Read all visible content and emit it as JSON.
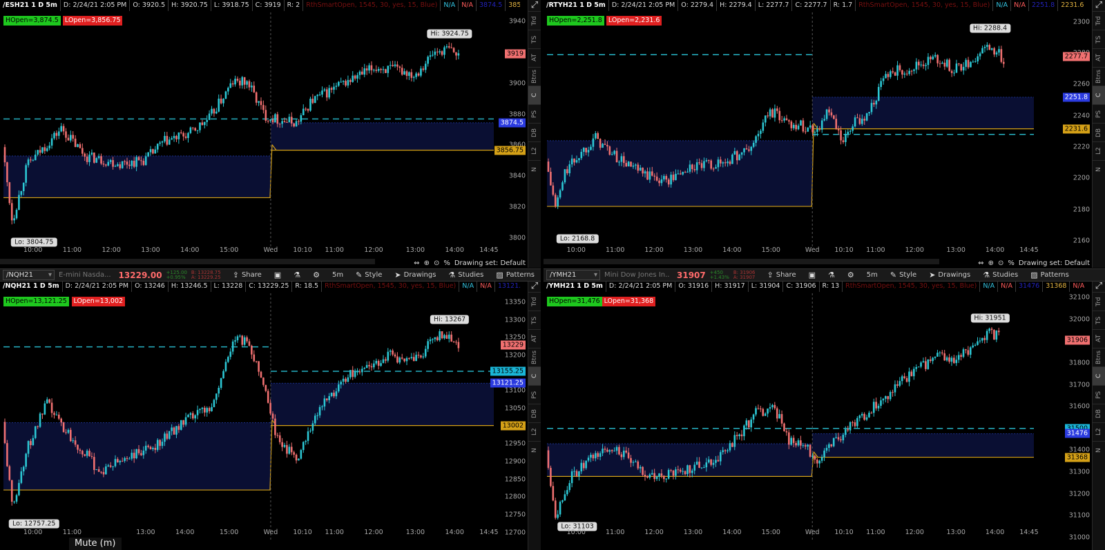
{
  "colors": {
    "up": "#2cc7d4",
    "down": "#f07070",
    "gold": "#d4a017",
    "cyan_dash": "#26b3c4",
    "fill": "#0a0f33"
  },
  "panels": [
    {
      "id": "es",
      "info": {
        "symbol": "/ESH21 1 D 5m",
        "date": "D: 2/24/21 2:05 PM",
        "o": "O: 3920.5",
        "h": "H: 3920.75",
        "l": "L: 3918.75",
        "c": "C: 3919",
        "r": "R: 2",
        "study": "RthSmartOpen, 1545, 30, yes, 15, Blue)",
        "na1": "N/A",
        "na2": "N/A",
        "blueval": "3874.5",
        "goldval": "3856.75",
        "na3": "N/A",
        "na4": "N/A"
      },
      "hopen": "HOpen=3,874.5",
      "lopen": "LOpen=3,856.75",
      "hi": "Hi: 3924.75",
      "lo": "Lo: 3804.75",
      "yticks": [
        "3940",
        "3920",
        "3900",
        "3880",
        "3860",
        "3840",
        "3820",
        "3800"
      ],
      "xticks": [
        "10:00",
        "11:00",
        "12:00",
        "13:00",
        "14:00",
        "15:00",
        "Wed",
        "10:10",
        "11:00",
        "12:00",
        "13:00",
        "14:00",
        "14:45"
      ],
      "labels": {
        "last": "3919",
        "blue": "3874.5",
        "gold": "3856.75"
      },
      "chart_data": {
        "type": "candlestick",
        "ylim": [
          3794,
          3946
        ],
        "open": 3868,
        "close": 3919,
        "lo": 3804.75,
        "hi": 3924.75,
        "hopen": 3874.5,
        "lopen": 3856.75,
        "prev_fill_top": 3853,
        "prev_fill_bottom": 3826
      }
    },
    {
      "id": "rty",
      "info": {
        "symbol": "/RTYH21 1 D 5m",
        "date": "D: 2/24/21 2:05 PM",
        "o": "O: 2279.4",
        "h": "H: 2279.4",
        "l": "L: 2277.7",
        "c": "C: 2277.7",
        "r": "R: 1.7",
        "study": "RthSmartOpen, 1545, 30, yes, 15, Blue)",
        "na1": "N/A",
        "na2": "N/A",
        "blueval": "2251.8",
        "goldval": "2231.6",
        "na3": "N/A",
        "na4": "N/A"
      },
      "hopen": "HOpen=2,251.8",
      "lopen": "LOpen=2,231.6",
      "hi": "Hi: 2288.4",
      "lo": "Lo: 2168.8",
      "yticks": [
        "2300",
        "2280",
        "2260",
        "2240",
        "2220",
        "2200",
        "2180",
        "2160"
      ],
      "xticks": [
        "10:00",
        "11:00",
        "12:00",
        "13:00",
        "14:00",
        "15:00",
        "Wed",
        "10:10",
        "11:00",
        "12:00",
        "13:00",
        "14:00",
        "14:45"
      ],
      "labels": {
        "last": "2277.7",
        "blue": "2251.8",
        "gold": "2231.6"
      },
      "chart_data": {
        "type": "candlestick",
        "ylim": [
          2156,
          2306
        ],
        "open": 2200,
        "close": 2277.7,
        "lo": 2168.8,
        "hi": 2288.4,
        "hopen": 2251.8,
        "lopen": 2231.6,
        "prev_fill_top": 2224,
        "prev_fill_bottom": 2182
      }
    },
    {
      "id": "nq",
      "info": {
        "symbol": "/NQH21 1 D 5m",
        "date": "D: 2/24/21 2:05 PM",
        "o": "O: 13246",
        "h": "H: 13246.5",
        "l": "L: 13228",
        "c": "C: 13229.25",
        "r": "R: 18.5",
        "study": "RthSmartOpen, 1545, 30, yes, 15, Blue)",
        "na1": "N/A",
        "na2": "N/A",
        "blueval": "13121.25",
        "goldval": "13002",
        "na3": "N/A",
        "na4": "N/A"
      },
      "hopen": "HOpen=13,121.25",
      "lopen": "LOpen=13,002",
      "hi": "Hi: 13267",
      "lo": "Lo: 12757.25",
      "yticks": [
        "13350",
        "13300",
        "13250",
        "13200",
        "13150",
        "13100",
        "13050",
        "13000",
        "12950",
        "12900",
        "12850",
        "12800",
        "12750",
        "12700"
      ],
      "xticks": [
        "10:00",
        "11:00",
        "13:00",
        "14:00",
        "15:00",
        "Wed",
        "10:10",
        "11:00",
        "12:00",
        "13:00",
        "14:00",
        "14:45"
      ],
      "labels": {
        "last": "13229",
        "cyan": "13155.25",
        "blue": "13121.25",
        "gold": "13002"
      },
      "chart_data": {
        "type": "candlestick",
        "ylim": [
          12680,
          13375
        ],
        "open": 12950,
        "close": 13229.25,
        "lo": 12757.25,
        "hi": 13267,
        "hopen": 13121.25,
        "lopen": 13002,
        "prev_fill_top": 13010,
        "prev_fill_bottom": 12820
      }
    },
    {
      "id": "ym",
      "info": {
        "symbol": "/YMH21 1 D 5m",
        "date": "D: 2/24/21 2:05 PM",
        "o": "O: 31916",
        "h": "H: 31917",
        "l": "L: 31904",
        "c": "C: 31906",
        "r": "R: 13",
        "study": "RthSmartOpen, 1545, 30, yes, 15, Blue)",
        "na1": "N/A",
        "na2": "N/A",
        "blueval": "31476",
        "goldval": "31368",
        "na3": "N/A",
        "na4": "N/A"
      },
      "hopen": "HOpen=31,476",
      "lopen": "LOpen=31,368",
      "hi": "Hi: 31951",
      "lo": "Lo: 31103",
      "yticks": [
        "32100",
        "32000",
        "31900",
        "31800",
        "31700",
        "31600",
        "31500",
        "31400",
        "31300",
        "31200",
        "31100",
        "31000"
      ],
      "xticks": [
        "10:00",
        "11:00",
        "12:00",
        "13:00",
        "14:00",
        "15:00",
        "Wed",
        "10:10",
        "11:00",
        "12:00",
        "13:00",
        "14:00",
        "14:45"
      ],
      "labels": {
        "last": "31906",
        "cyan": "31500",
        "blue": "31476",
        "gold": "31368"
      },
      "chart_data": {
        "type": "candlestick",
        "ylim": [
          30990,
          32120
        ],
        "open": 31300,
        "close": 31906,
        "lo": 31103,
        "hi": 31951,
        "hopen": 31476,
        "lopen": 31368,
        "prev_fill_top": 31430,
        "prev_fill_bottom": 31280
      }
    }
  ],
  "sidebar_items": [
    "Trd",
    "TS",
    "AT",
    "Btns",
    "C",
    "PS",
    "DB",
    "L2",
    "N"
  ],
  "nav": {
    "drawing_set": "Drawing set: Default",
    "pct": "%"
  },
  "toolbars": [
    {
      "symbol": "/NQH21",
      "desc": "E-mini Nasda...",
      "price": "13229.00",
      "chg1": "+125.00",
      "chg2": "+0.95%",
      "bid": "B: 13228.75",
      "ask": "A: 13229.25",
      "share": "Share",
      "style": "Style",
      "drawings": "Drawings",
      "studies": "Studies",
      "patterns": "Patterns",
      "agg": "5m"
    },
    {
      "symbol": "/YMH21",
      "desc": "Mini Dow Jones In...",
      "price": "31907",
      "chg1": "+450",
      "chg2": "+1.43%",
      "bid": "B: 31906",
      "ask": "A: 31907",
      "share": "Share",
      "style": "Style",
      "drawings": "Drawings",
      "studies": "Studies",
      "patterns": "Patterns",
      "agg": "5m"
    }
  ],
  "mute": "Mute (m)"
}
